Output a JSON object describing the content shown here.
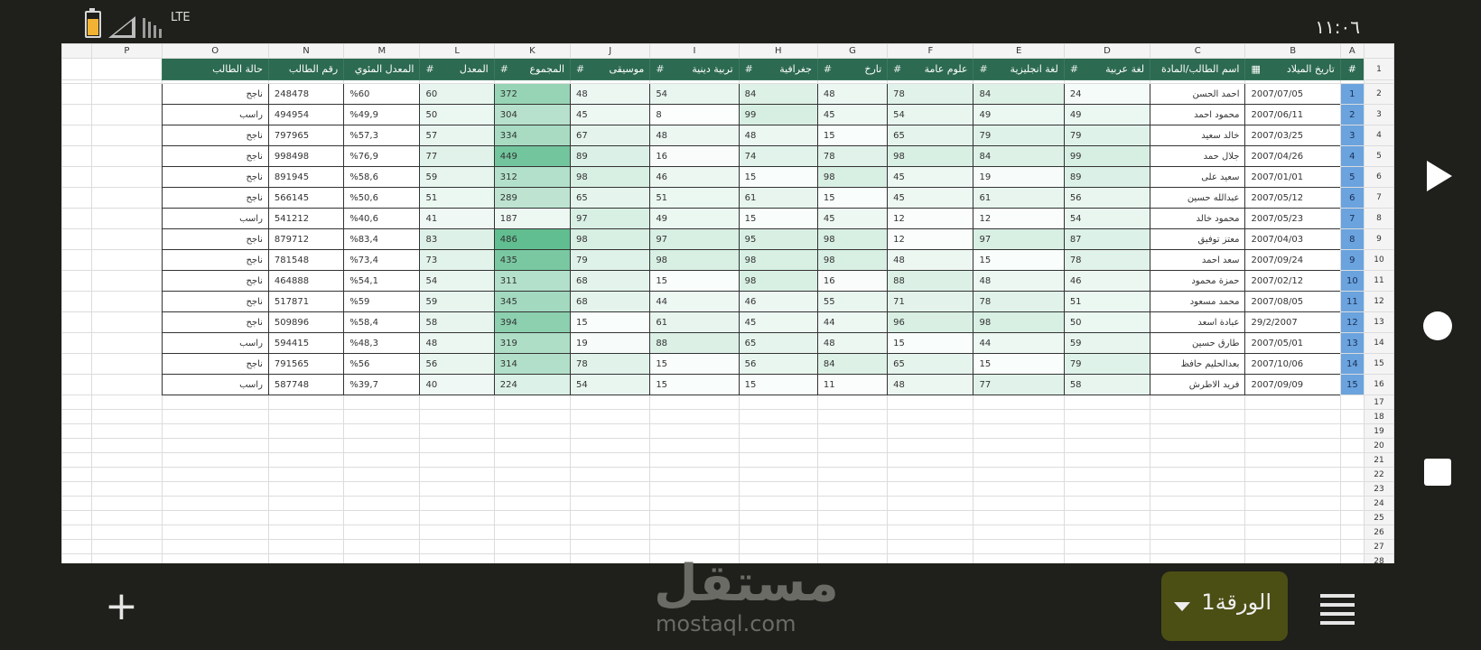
{
  "status": {
    "time": "١١:٠٦",
    "network": "LTE",
    "battery_color": "#f2b233"
  },
  "columns": [
    "#",
    "B",
    "C",
    "D",
    "E",
    "F",
    "G",
    "H",
    "I",
    "J",
    "K",
    "L",
    "M",
    "N",
    "O",
    "P"
  ],
  "col_letters": [
    "A",
    "B",
    "C",
    "D",
    "E",
    "F",
    "G",
    "H",
    "I",
    "J",
    "K",
    "L",
    "M",
    "N",
    "O",
    "P"
  ],
  "headers": {
    "idx": "#",
    "birth": "تاريخ الميلاد",
    "name": "اسم الطالب/المادة",
    "arabic": "لغة عربية",
    "english": "لغة انجليزية",
    "science": "علوم عامة",
    "history": "تارخ",
    "geography": "جغرافية",
    "religion": "تربية دينية",
    "music": "موسيقى",
    "total": "المجموع",
    "average": "المعدل",
    "percent": "المعدل المئوي",
    "student_no": "رقم الطالب",
    "status": "حالة الطالب",
    "hash": "#"
  },
  "rows": [
    {
      "idx": "1",
      "birth": "2007/07/05",
      "name": "احمد الحسن",
      "arabic": "24",
      "english": "84",
      "science": "78",
      "history": "48",
      "geography": "84",
      "religion": "54",
      "music": "48",
      "total": "372",
      "average": "60",
      "percent": "%60",
      "student_no": "248478",
      "status": "ناجح"
    },
    {
      "idx": "2",
      "birth": "2007/06/11",
      "name": "محمود احمد",
      "arabic": "49",
      "english": "49",
      "science": "54",
      "history": "45",
      "geography": "99",
      "religion": "8",
      "music": "45",
      "total": "304",
      "average": "50",
      "percent": "%49,9",
      "student_no": "494954",
      "status": "راسب"
    },
    {
      "idx": "3",
      "birth": "2007/03/25",
      "name": "خالد سعيد",
      "arabic": "79",
      "english": "79",
      "science": "65",
      "history": "15",
      "geography": "48",
      "religion": "48",
      "music": "67",
      "total": "334",
      "average": "57",
      "percent": "%57,3",
      "student_no": "797965",
      "status": "ناجح"
    },
    {
      "idx": "4",
      "birth": "2007/04/26",
      "name": "جلال حمد",
      "arabic": "99",
      "english": "84",
      "science": "98",
      "history": "78",
      "geography": "74",
      "religion": "16",
      "music": "89",
      "total": "449",
      "average": "77",
      "percent": "%76,9",
      "student_no": "998498",
      "status": "ناجح"
    },
    {
      "idx": "5",
      "birth": "2007/01/01",
      "name": "سعيد على",
      "arabic": "89",
      "english": "19",
      "science": "45",
      "history": "98",
      "geography": "15",
      "religion": "46",
      "music": "98",
      "total": "312",
      "average": "59",
      "percent": "%58,6",
      "student_no": "891945",
      "status": "ناجح"
    },
    {
      "idx": "6",
      "birth": "2007/05/12",
      "name": "عبدالله حسين",
      "arabic": "56",
      "english": "61",
      "science": "45",
      "history": "15",
      "geography": "61",
      "religion": "51",
      "music": "65",
      "total": "289",
      "average": "51",
      "percent": "%50,6",
      "student_no": "566145",
      "status": "ناجح"
    },
    {
      "idx": "7",
      "birth": "2007/05/23",
      "name": "محمود خالد",
      "arabic": "54",
      "english": "12",
      "science": "12",
      "history": "45",
      "geography": "15",
      "religion": "49",
      "music": "97",
      "total": "187",
      "average": "41",
      "percent": "%40,6",
      "student_no": "541212",
      "status": "راسب"
    },
    {
      "idx": "8",
      "birth": "2007/04/03",
      "name": "معتز توفيق",
      "arabic": "87",
      "english": "97",
      "science": "12",
      "history": "98",
      "geography": "95",
      "religion": "97",
      "music": "98",
      "total": "486",
      "average": "83",
      "percent": "%83,4",
      "student_no": "879712",
      "status": "ناجح"
    },
    {
      "idx": "9",
      "birth": "2007/09/24",
      "name": "سعد احمد",
      "arabic": "78",
      "english": "15",
      "science": "48",
      "history": "98",
      "geography": "98",
      "religion": "98",
      "music": "79",
      "total": "435",
      "average": "73",
      "percent": "%73,4",
      "student_no": "781548",
      "status": "ناجح"
    },
    {
      "idx": "10",
      "birth": "2007/02/12",
      "name": "حمزة محمود",
      "arabic": "46",
      "english": "48",
      "science": "88",
      "history": "16",
      "geography": "98",
      "religion": "15",
      "music": "68",
      "total": "311",
      "average": "54",
      "percent": "%54,1",
      "student_no": "464888",
      "status": "ناجح"
    },
    {
      "idx": "11",
      "birth": "2007/08/05",
      "name": "محمد مسعود",
      "arabic": "51",
      "english": "78",
      "science": "71",
      "history": "55",
      "geography": "46",
      "religion": "44",
      "music": "68",
      "total": "345",
      "average": "59",
      "percent": "%59",
      "student_no": "517871",
      "status": "ناجح"
    },
    {
      "idx": "12",
      "birth": "29/2/2007",
      "name": "عبادة اسعد",
      "arabic": "50",
      "english": "98",
      "science": "96",
      "history": "44",
      "geography": "45",
      "religion": "61",
      "music": "15",
      "total": "394",
      "average": "58",
      "percent": "%58,4",
      "student_no": "509896",
      "status": "ناجح"
    },
    {
      "idx": "13",
      "birth": "2007/05/01",
      "name": "طارق حسين",
      "arabic": "59",
      "english": "44",
      "science": "15",
      "history": "48",
      "geography": "65",
      "religion": "88",
      "music": "19",
      "total": "319",
      "average": "48",
      "percent": "%48,3",
      "student_no": "594415",
      "status": "راسب"
    },
    {
      "idx": "14",
      "birth": "2007/10/06",
      "name": "بعدالحليم حافظ",
      "arabic": "79",
      "english": "15",
      "science": "65",
      "history": "84",
      "geography": "56",
      "religion": "15",
      "music": "78",
      "total": "314",
      "average": "56",
      "percent": "%56",
      "student_no": "791565",
      "status": "ناجح"
    },
    {
      "idx": "15",
      "birth": "2007/09/09",
      "name": "فريد الاطرش",
      "arabic": "58",
      "english": "77",
      "science": "48",
      "history": "11",
      "geography": "15",
      "religion": "15",
      "music": "54",
      "total": "224",
      "average": "40",
      "percent": "%39,7",
      "student_no": "587748",
      "status": "راسب"
    }
  ],
  "row_numbers": [
    "1",
    "2",
    "3",
    "4",
    "5",
    "6",
    "7",
    "8",
    "9",
    "10",
    "11",
    "12",
    "13",
    "14",
    "15",
    "16",
    "17",
    "18",
    "19",
    "20",
    "21",
    "22",
    "23",
    "24",
    "25",
    "26",
    "27",
    "28"
  ],
  "bottom": {
    "add_sheet": "+",
    "sheet_tab": "الورقة1",
    "watermark": "مستقل",
    "watermark_sub": "mostaql.com"
  },
  "colors": {
    "header_green": "#2c6a51",
    "index_blue": "#6aa3de",
    "total_green": "#5fbd8f"
  }
}
